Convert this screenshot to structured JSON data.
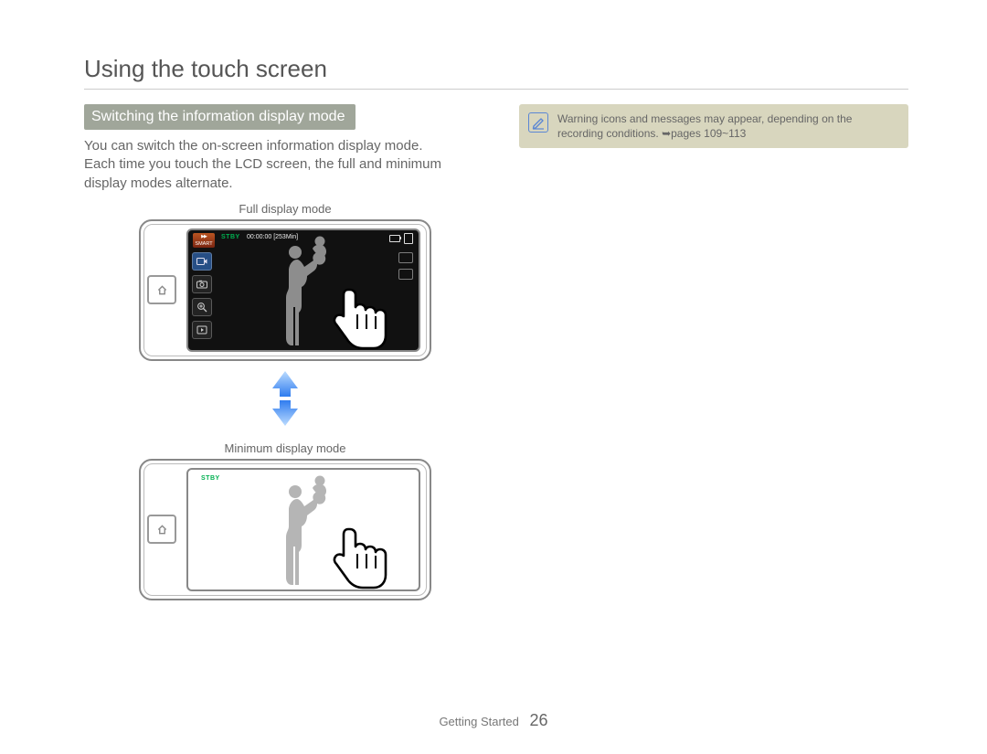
{
  "title": "Using the touch screen",
  "subhead": "Switching the information display mode",
  "body": "You can switch the on-screen information display mode.\nEach time you touch the LCD screen, the full and minimum display modes alternate.",
  "note": {
    "text": "Warning icons and messages may appear, depending on the recording conditions. ➥pages 109~113"
  },
  "captions": {
    "full": "Full display mode",
    "min": "Minimum display mode"
  },
  "full_screen": {
    "smart_label": "SMART",
    "status": "STBY",
    "timecode": "00:00:00 [253Min]",
    "icons": {
      "film": "film-icon",
      "camera": "camera-icon",
      "zoom": "magnifier-plus-icon",
      "play": "play-icon",
      "battery": "battery-icon",
      "card": "sd-card-icon"
    }
  },
  "min_screen": {
    "status": "STBY"
  },
  "footer": {
    "section": "Getting Started",
    "page": "26"
  }
}
